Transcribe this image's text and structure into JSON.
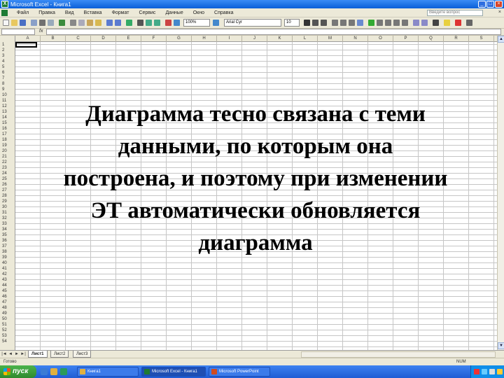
{
  "window": {
    "title": "Microsoft Excel - Книга1",
    "app_icon_glyph": "X",
    "buttons": [
      "_",
      "□",
      "×"
    ]
  },
  "menu": {
    "items": [
      "Файл",
      "Правка",
      "Вид",
      "Вставка",
      "Формат",
      "Сервис",
      "Данные",
      "Окно",
      "Справка"
    ],
    "help_placeholder": "Введите вопрос",
    "close_doc": "×"
  },
  "toolbar": {
    "zoom": "100%",
    "font_name": "Arial Cyr",
    "font_size": "10"
  },
  "formula_bar": {
    "fx": "fx"
  },
  "sheet": {
    "columns": [
      "A",
      "B",
      "C",
      "D",
      "E",
      "F",
      "G",
      "H",
      "I",
      "J",
      "K",
      "L",
      "M",
      "N",
      "O",
      "P",
      "Q",
      "R",
      "S"
    ],
    "rows": [
      "1",
      "2",
      "3",
      "4",
      "5",
      "6",
      "7",
      "8",
      "9",
      "10",
      "11",
      "12",
      "13",
      "14",
      "15",
      "16",
      "17",
      "18",
      "19",
      "20",
      "21",
      "22",
      "23",
      "24",
      "25",
      "26",
      "27",
      "28",
      "29",
      "30",
      "31",
      "32",
      "33",
      "34",
      "35",
      "36",
      "37",
      "38",
      "39",
      "40",
      "41",
      "42",
      "43",
      "44",
      "45",
      "46",
      "47",
      "48",
      "49",
      "50",
      "51",
      "52",
      "53",
      "54"
    ],
    "active_cell": "A1"
  },
  "tabs": {
    "nav": [
      "|◄",
      "◄",
      "►",
      "►|"
    ],
    "sheets": [
      "Лист1",
      "Лист2",
      "Лист3"
    ],
    "active": "Лист1"
  },
  "status": {
    "ready": "Готово",
    "num": "NUM"
  },
  "taskbar": {
    "start_label": "пуск",
    "tasks": [
      "Книга1",
      "Microsoft Excel - Книга1",
      "Microsoft PowerPoint"
    ],
    "active_task": "Microsoft Excel - Книга1",
    "time": ""
  },
  "overlay_text": {
    "lines": [
      "Диаграмма тесно связана с теми",
      "данными, по которым она",
      "построена, и поэтому при изменении",
      "ЭТ автоматически обновляется",
      "диаграмма"
    ]
  },
  "colors": {
    "excel_green": "#1e7b34",
    "xp_blue": "#1f5cd4",
    "start_green": "#3a9f3a",
    "chrome": "#ece9d8"
  }
}
